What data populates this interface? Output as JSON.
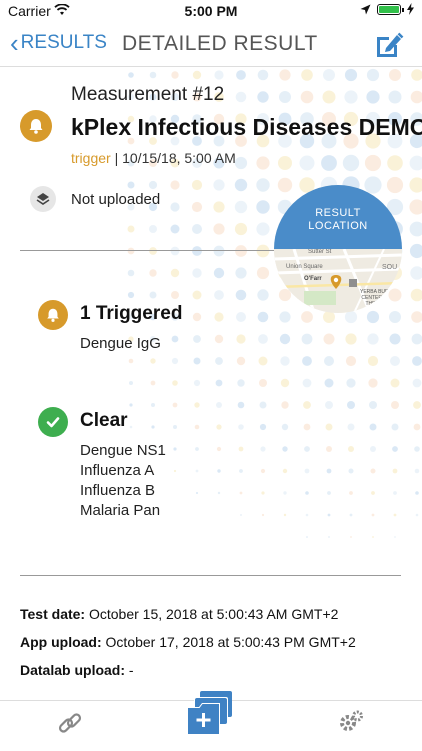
{
  "status": {
    "carrier": "Carrier",
    "time": "5:00 PM"
  },
  "nav": {
    "back_label": "RESULTS",
    "title": "DETAILED RESULT"
  },
  "measurement": {
    "label": "Measurement #12",
    "test_name": "kPlex Infectious Diseases DEMO",
    "status_word": "trigger",
    "separator": " | ",
    "datetime": "10/15/18, 5:00 AM"
  },
  "upload_status": "Not uploaded",
  "map": {
    "label_line1": "RESULT",
    "label_line2": "LOCATION",
    "streets": [
      "Sutter St",
      "Union Square",
      "O'Farr",
      "SOU",
      "YERBA BUENA",
      "CENTER FOR",
      "THE ARTS"
    ]
  },
  "triggered": {
    "title": "1 Triggered",
    "items": [
      "Dengue IgG"
    ]
  },
  "clear": {
    "title": "Clear",
    "items": [
      "Dengue NS1",
      "Influenza A",
      "Influenza B",
      "Malaria Pan"
    ]
  },
  "details": {
    "test_date_label": "Test date:",
    "test_date_value": "October 15, 2018 at 5:00:43 AM GMT+2",
    "app_upload_label": "App upload:",
    "app_upload_value": "October 17, 2018 at 5:00:43 PM GMT+2",
    "datalab_upload_label": "Datalab upload:",
    "datalab_upload_value": "-"
  },
  "colors": {
    "accent": "#3a84c6",
    "trigger": "#d79a2b",
    "clear": "#3eae4f",
    "map_blue": "#4a8cc9"
  },
  "icons": [
    "wifi-icon",
    "location-arrow-icon",
    "battery-icon",
    "charging-icon",
    "edit-icon",
    "bell-icon",
    "upload-icon",
    "check-icon",
    "link-icon",
    "add-folder-icon",
    "gear-icon"
  ]
}
